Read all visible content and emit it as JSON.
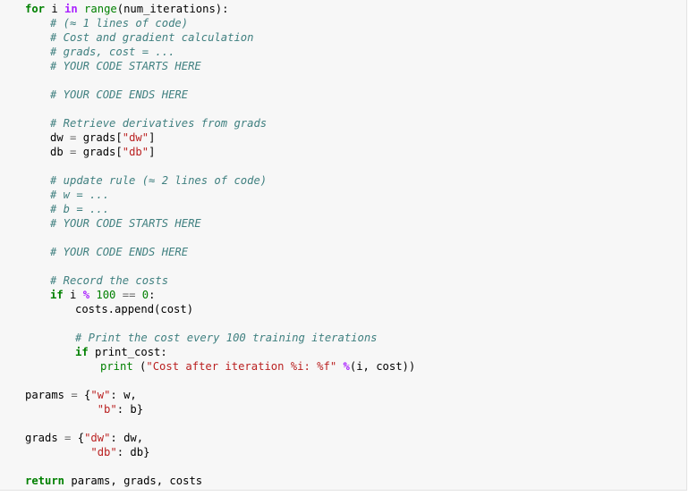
{
  "code": {
    "for_kw": "for",
    "for_var": " i ",
    "in_kw": "in",
    "range_fn": " range",
    "range_arg": "(num_iterations):",
    "cm_approx_1": "# (≈ 1 lines of code)",
    "cm_cost_grad": "# Cost and gradient calculation",
    "cm_grads_cost": "# grads, cost = ...",
    "cm_start_1": "# YOUR CODE STARTS HERE",
    "cm_end_1": "# YOUR CODE ENDS HERE",
    "cm_retrieve": "# Retrieve derivatives from grads",
    "dw_lhs": "dw ",
    "dw_eq": "=",
    "dw_rhs_pre": " grads[",
    "dw_key": "\"dw\"",
    "dw_rhs_post": "]",
    "db_lhs": "db ",
    "db_eq": "=",
    "db_rhs_pre": " grads[",
    "db_key": "\"db\"",
    "db_rhs_post": "]",
    "cm_update": "# update rule (≈ 2 lines of code)",
    "cm_w": "# w = ...",
    "cm_b": "# b = ...",
    "cm_start_2": "# YOUR CODE STARTS HERE",
    "cm_end_2": "# YOUR CODE ENDS HERE",
    "cm_record": "# Record the costs",
    "if1_kw": "if",
    "if1_var": " i ",
    "if1_mod": "%",
    "if1_num1": " 100",
    "if1_eqeq": " ==",
    "if1_num2": " 0",
    "if1_colon": ":",
    "costs_append": "costs.append(cost)",
    "cm_print": "# Print the cost every 100 training iterations",
    "if2_kw": "if",
    "if2_rest": " print_cost:",
    "print_kw": "print",
    "print_open": " (",
    "print_str": "\"Cost after iteration %i: %f\"",
    "print_space": " ",
    "print_mod": "%",
    "print_args": "(i, cost))",
    "params_lhs": "params ",
    "params_eq": "=",
    "params_open": " {",
    "params_w_key": "\"w\"",
    "params_w_val": ": w,",
    "params_pad": "           ",
    "params_b_key": "\"b\"",
    "params_b_val": ": b}",
    "grads_lhs": "grads ",
    "grads_eq": "=",
    "grads_open": " {",
    "grads_dw_key": "\"dw\"",
    "grads_dw_val": ": dw,",
    "grads_pad": "          ",
    "grads_db_key": "\"db\"",
    "grads_db_val": ": db}",
    "return_kw": "return",
    "return_rest": " params, grads, costs"
  }
}
